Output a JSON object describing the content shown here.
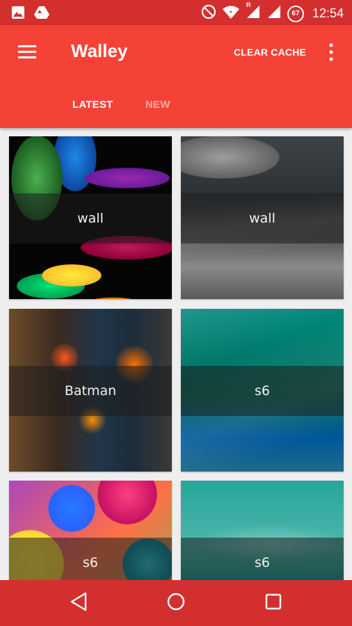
{
  "status_bar": {
    "time": "12:54",
    "battery_level": "67",
    "network_label": "R",
    "icons": [
      "image-icon",
      "drive-icon",
      "do-not-disturb-icon",
      "wifi-icon",
      "signal-icon",
      "signal-icon-2",
      "battery-icon"
    ]
  },
  "app_bar": {
    "title": "Walley",
    "clear_cache_label": "CLEAR CACHE",
    "menu_icon": "menu-icon",
    "more_icon": "more-vert-icon",
    "tabs": [
      {
        "label": "LATEST",
        "selected": true
      },
      {
        "label": "NEW",
        "selected": false
      }
    ]
  },
  "wallpapers": [
    {
      "label": "wall"
    },
    {
      "label": "wall"
    },
    {
      "label": "Batman"
    },
    {
      "label": "s6"
    },
    {
      "label": "s6"
    },
    {
      "label": "s6"
    }
  ],
  "nav_bar": {
    "icons": [
      "back-icon",
      "home-icon",
      "recents-icon"
    ]
  },
  "colors": {
    "status_bar": "#d32f2f",
    "app_bar": "#f44336",
    "nav_bar": "#d32f2f",
    "background": "#eeeeee"
  }
}
